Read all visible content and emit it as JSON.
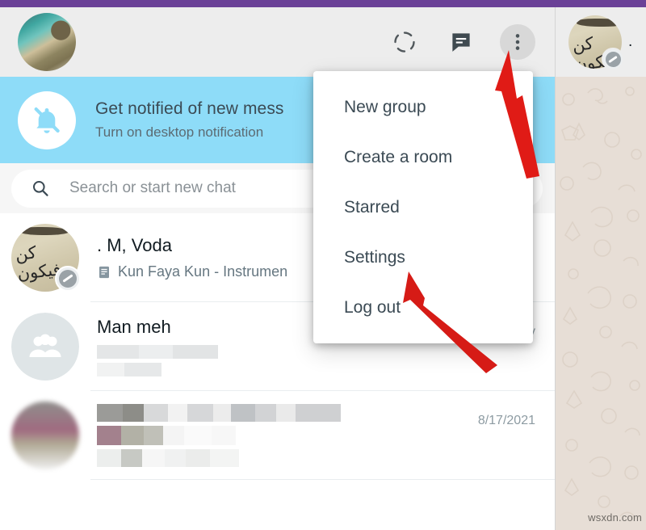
{
  "window": {
    "accent_purple": "#6b4197"
  },
  "left_panel": {
    "header": {
      "profile_avatar_name": "user-profile-photo",
      "icons": [
        {
          "name": "status-icon",
          "label": "Status"
        },
        {
          "name": "new-chat-icon",
          "label": "New chat"
        },
        {
          "name": "menu-icon",
          "label": "Menu"
        }
      ]
    },
    "notification_banner": {
      "icon": "bell-muted-icon",
      "title": "Get notified of new mess",
      "subtitle": "Turn on desktop notification",
      "background": "#8edcf8"
    },
    "search": {
      "icon": "search-icon",
      "placeholder": "Search or start new chat",
      "value": ""
    },
    "chats": [
      {
        "name": ". M, Voda",
        "preview": "Kun Faya Kun - Instrumen",
        "preview_icon": "document-icon",
        "time": "",
        "avatar_type": "calligraphy",
        "has_status_badge": true
      },
      {
        "name": "Man meh",
        "preview": "",
        "preview_icon": "",
        "time": "Thursday",
        "avatar_type": "group",
        "has_status_badge": false
      },
      {
        "name": "",
        "preview": "",
        "preview_icon": "",
        "time": "8/17/2021",
        "avatar_type": "blurred",
        "has_status_badge": false
      }
    ]
  },
  "menu": {
    "items": [
      {
        "label": "New group",
        "name": "menu-item-new-group"
      },
      {
        "label": "Create a room",
        "name": "menu-item-create-a-room"
      },
      {
        "label": "Starred",
        "name": "menu-item-starred"
      },
      {
        "label": "Settings",
        "name": "menu-item-settings"
      },
      {
        "label": "Log out",
        "name": "menu-item-log-out"
      }
    ]
  },
  "right_panel": {
    "chat_header_name": ".",
    "background": "#e7ded6",
    "watermark": "wsxdn.com"
  },
  "annotations": {
    "arrow_color": "#e01b16",
    "arrows": [
      {
        "name": "arrow-to-menu-icon",
        "points_at": "menu-icon"
      },
      {
        "name": "arrow-to-settings",
        "points_at": "menu-item-settings"
      }
    ]
  }
}
